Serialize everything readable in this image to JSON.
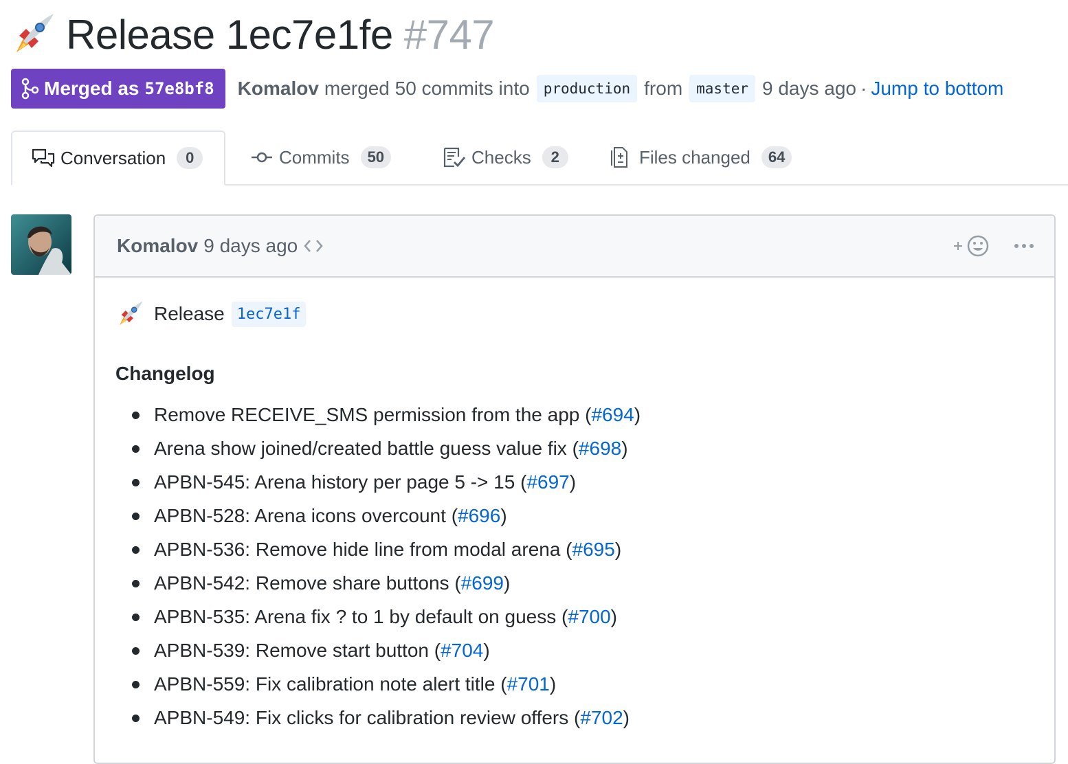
{
  "title": {
    "text": "Release 1ec7e1fe",
    "number": "#747",
    "icon": "rocket-icon"
  },
  "meta": {
    "state_label": "Merged as",
    "merge_sha": "57e8bf8",
    "author": "Komalov",
    "merged_text": "merged 50 commits into",
    "base_branch": "production",
    "from_text": "from",
    "head_branch": "master",
    "time": "9 days ago",
    "separator": "·",
    "jump_link": "Jump to bottom"
  },
  "tabs": [
    {
      "label": "Conversation",
      "count": "0",
      "icon": "comment-discussion-icon",
      "active": true
    },
    {
      "label": "Commits",
      "count": "50",
      "icon": "git-commit-icon",
      "active": false
    },
    {
      "label": "Checks",
      "count": "2",
      "icon": "checklist-icon",
      "active": false
    },
    {
      "label": "Files changed",
      "count": "64",
      "icon": "file-diff-icon",
      "active": false
    }
  ],
  "comment": {
    "author": "Komalov",
    "time": "9 days ago",
    "release_label": "Release",
    "release_sha": "1ec7e1f",
    "changelog_heading": "Changelog",
    "items": [
      {
        "text": "Remove RECEIVE_SMS permission from the app",
        "ref": "#694"
      },
      {
        "text": "Arena show joined/created battle guess value fix",
        "ref": "#698"
      },
      {
        "text": "APBN-545: Arena history per page 5 -> 15",
        "ref": "#697"
      },
      {
        "text": "APBN-528: Arena icons overcount",
        "ref": "#696"
      },
      {
        "text": "APBN-536: Remove hide line from modal arena",
        "ref": "#695"
      },
      {
        "text": "APBN-542: Remove share buttons",
        "ref": "#699"
      },
      {
        "text": "APBN-535: Arena fix ? to 1 by default on guess",
        "ref": "#700"
      },
      {
        "text": "APBN-539: Remove start button",
        "ref": "#704"
      },
      {
        "text": "APBN-559: Fix calibration note alert title",
        "ref": "#701"
      },
      {
        "text": "APBN-549: Fix clicks for calibration review offers",
        "ref": "#702"
      }
    ]
  },
  "colors": {
    "merged": "#6f42c1",
    "link": "#0366d6",
    "muted": "#586069"
  }
}
